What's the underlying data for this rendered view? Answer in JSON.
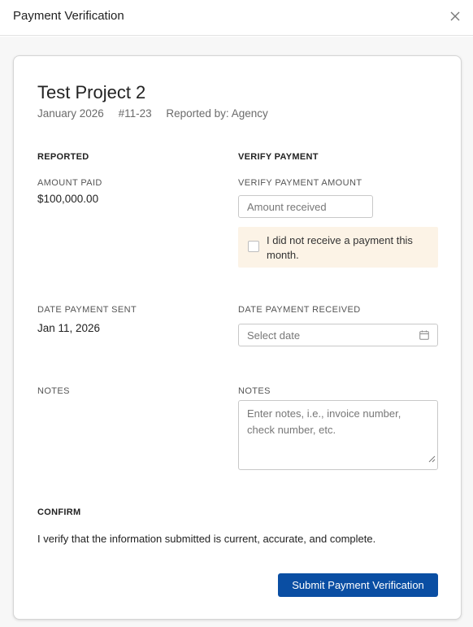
{
  "dialog": {
    "title": "Payment Verification"
  },
  "project": {
    "name": "Test Project 2",
    "period": "January 2026",
    "id": "#11-23",
    "reported_by": "Reported by: Agency"
  },
  "reported": {
    "heading": "REPORTED",
    "amount_label": "AMOUNT PAID",
    "amount_value": "$100,000.00",
    "date_label": "DATE PAYMENT SENT",
    "date_value": "Jan 11, 2026",
    "notes_label": "NOTES"
  },
  "verify": {
    "heading": "VERIFY PAYMENT",
    "amount_label": "VERIFY PAYMENT AMOUNT",
    "amount_placeholder": "Amount received",
    "no_payment_label": "I did not receive a payment this month.",
    "no_payment_checked": false,
    "date_label": "DATE PAYMENT RECEIVED",
    "date_placeholder": "Select date",
    "notes_label": "NOTES",
    "notes_placeholder": "Enter notes, i.e., invoice number, check number, etc."
  },
  "confirm": {
    "heading": "CONFIRM",
    "text": "I verify that the information submitted is current, accurate, and complete."
  },
  "actions": {
    "submit_label": "Submit Payment Verification"
  },
  "colors": {
    "primary": "#0a4ea3",
    "notice_bg": "#fcf3e6"
  },
  "icons": {
    "close": "close-icon",
    "calendar": "calendar-icon",
    "resize": "resize-grip-icon"
  }
}
